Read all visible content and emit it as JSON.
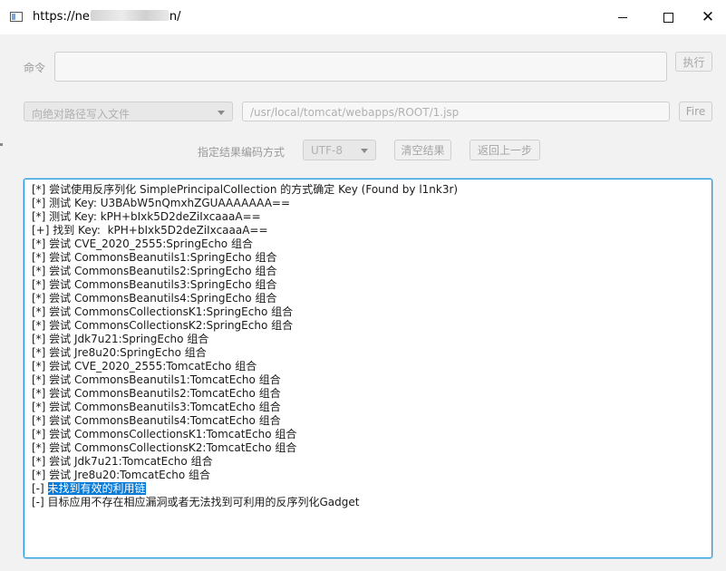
{
  "window": {
    "title_prefix": "https://ne",
    "title_suffix": "n/"
  },
  "command": {
    "label": "命令",
    "value": "",
    "execute_button": "执行"
  },
  "write": {
    "mode_select": "向绝对路径写入文件",
    "path": "/usr/local/tomcat/webapps/ROOT/1.jsp",
    "fire_button": "Fire"
  },
  "encoding": {
    "label": "指定结果编码方式",
    "value": "UTF-8",
    "clear_button": "清空结果",
    "back_button": "返回上一步"
  },
  "output": {
    "lines": [
      "[*] 尝试使用反序列化 SimplePrincipalCollection 的方式确定 Key (Found by l1nk3r)",
      "[*] 测试 Key: U3BAbW5nQmxhZGUAAAAAAA==",
      "[*] 测试 Key: kPH+bIxk5D2deZiIxcaaaA==",
      "[+] 找到 Key:  kPH+bIxk5D2deZiIxcaaaA==",
      "[*] 尝试 CVE_2020_2555:SpringEcho 组合",
      "[*] 尝试 CommonsBeanutils1:SpringEcho 组合",
      "[*] 尝试 CommonsBeanutils2:SpringEcho 组合",
      "[*] 尝试 CommonsBeanutils3:SpringEcho 组合",
      "[*] 尝试 CommonsBeanutils4:SpringEcho 组合",
      "[*] 尝试 CommonsCollectionsK1:SpringEcho 组合",
      "[*] 尝试 CommonsCollectionsK2:SpringEcho 组合",
      "[*] 尝试 Jdk7u21:SpringEcho 组合",
      "[*] 尝试 Jre8u20:SpringEcho 组合",
      "[*] 尝试 CVE_2020_2555:TomcatEcho 组合",
      "[*] 尝试 CommonsBeanutils1:TomcatEcho 组合",
      "[*] 尝试 CommonsBeanutils2:TomcatEcho 组合",
      "[*] 尝试 CommonsBeanutils3:TomcatEcho 组合",
      "[*] 尝试 CommonsBeanutils4:TomcatEcho 组合",
      "[*] 尝试 CommonsCollectionsK1:TomcatEcho 组合",
      "[*] 尝试 CommonsCollectionsK2:TomcatEcho 组合",
      "[*] 尝试 Jdk7u21:TomcatEcho 组合",
      "[*] 尝试 Jre8u20:TomcatEcho 组合"
    ],
    "fail_prefix": "[-] ",
    "fail_highlight": "未找到有效的利用链",
    "last_line": "[-] 目标应用不存在相应漏洞或者无法找到可利用的反序列化Gadget"
  },
  "colors": {
    "accent": "#1e9be0",
    "selection": "#0a7bd6",
    "disabled_text": "#a5a5a5"
  }
}
